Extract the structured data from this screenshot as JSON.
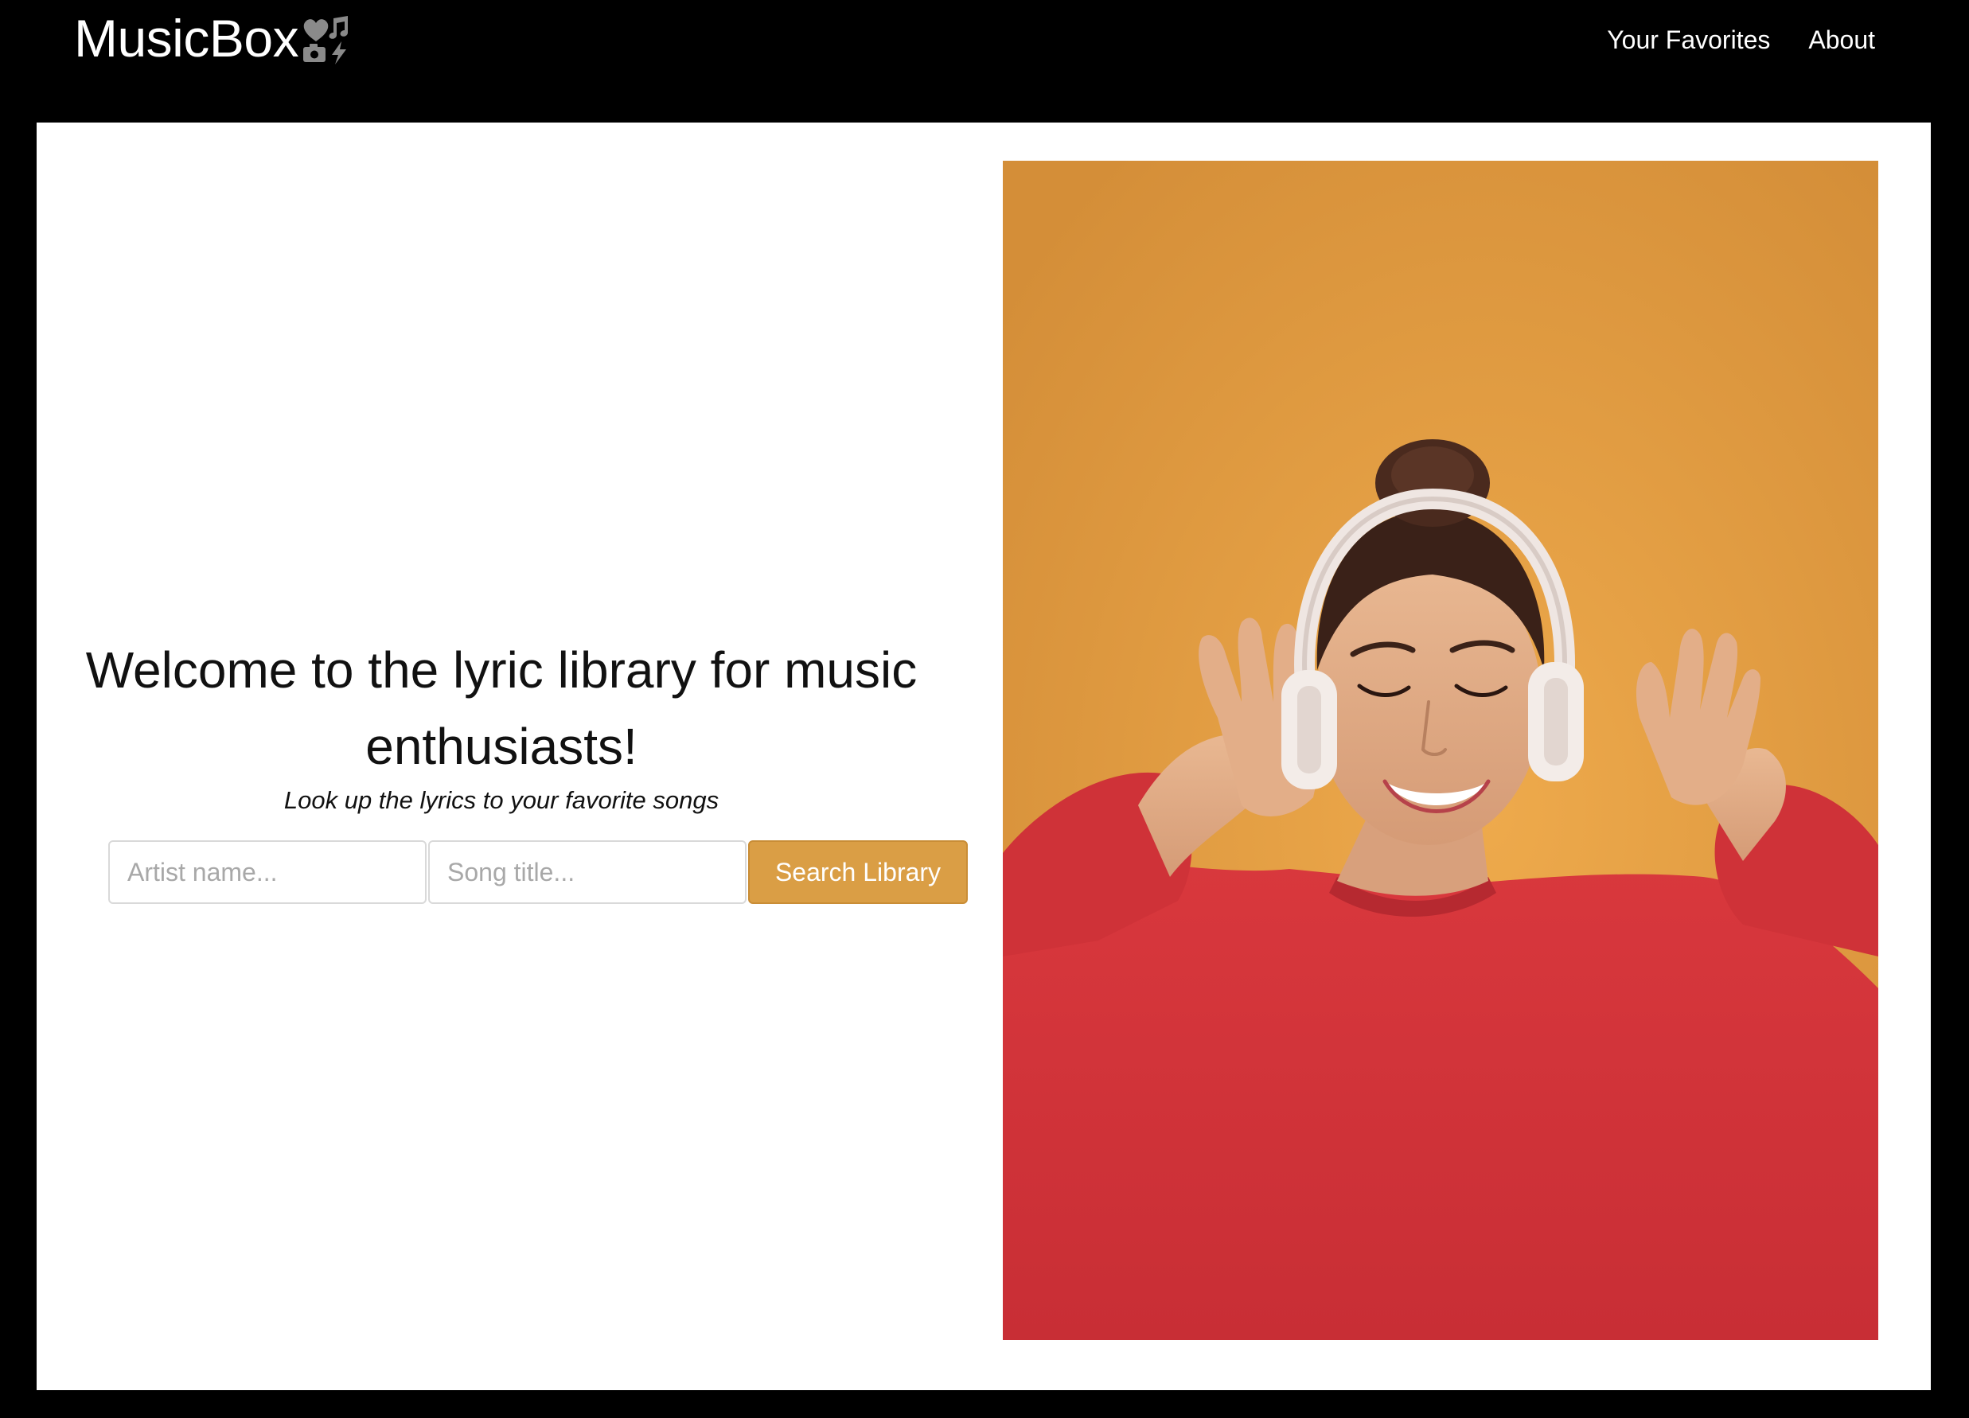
{
  "header": {
    "brand": "MusicBox",
    "brand_icon": "music-heart-camera-icon",
    "nav": [
      {
        "label": "Your Favorites"
      },
      {
        "label": "About"
      }
    ]
  },
  "hero": {
    "title": "Welcome to the lyric library for music enthusiasts!",
    "subtitle": "Look up the lyrics to your favorite songs"
  },
  "search": {
    "artist_placeholder": "Artist name...",
    "song_placeholder": "Song title...",
    "button_label": "Search Library"
  },
  "colors": {
    "background": "#000000",
    "card": "#ffffff",
    "accent": "#da9e45",
    "photo_backdrop": "#e39b42",
    "sweater": "#d3343a"
  }
}
